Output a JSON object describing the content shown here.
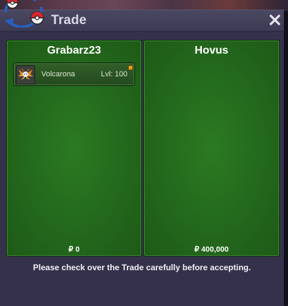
{
  "window": {
    "title": "Trade",
    "close_label": "×"
  },
  "trade": {
    "left": {
      "player": "Grabarz23",
      "items": [
        {
          "pokemon": "Volcarona",
          "level": "Lvl: 100"
        }
      ],
      "money": "₽ 0"
    },
    "right": {
      "player": "Hovus",
      "items": [],
      "money": "₽ 400,000"
    }
  },
  "footer": {
    "note": "Please check over the Trade carefully before accepting."
  },
  "colors": {
    "panel_green": "#23681c",
    "window_bg": "#35314b",
    "title_text": "#d7d8e6"
  },
  "icons": {
    "logo": "pokeball-logo-icon",
    "close": "close-icon",
    "pokemon": "volcarona-icon"
  }
}
